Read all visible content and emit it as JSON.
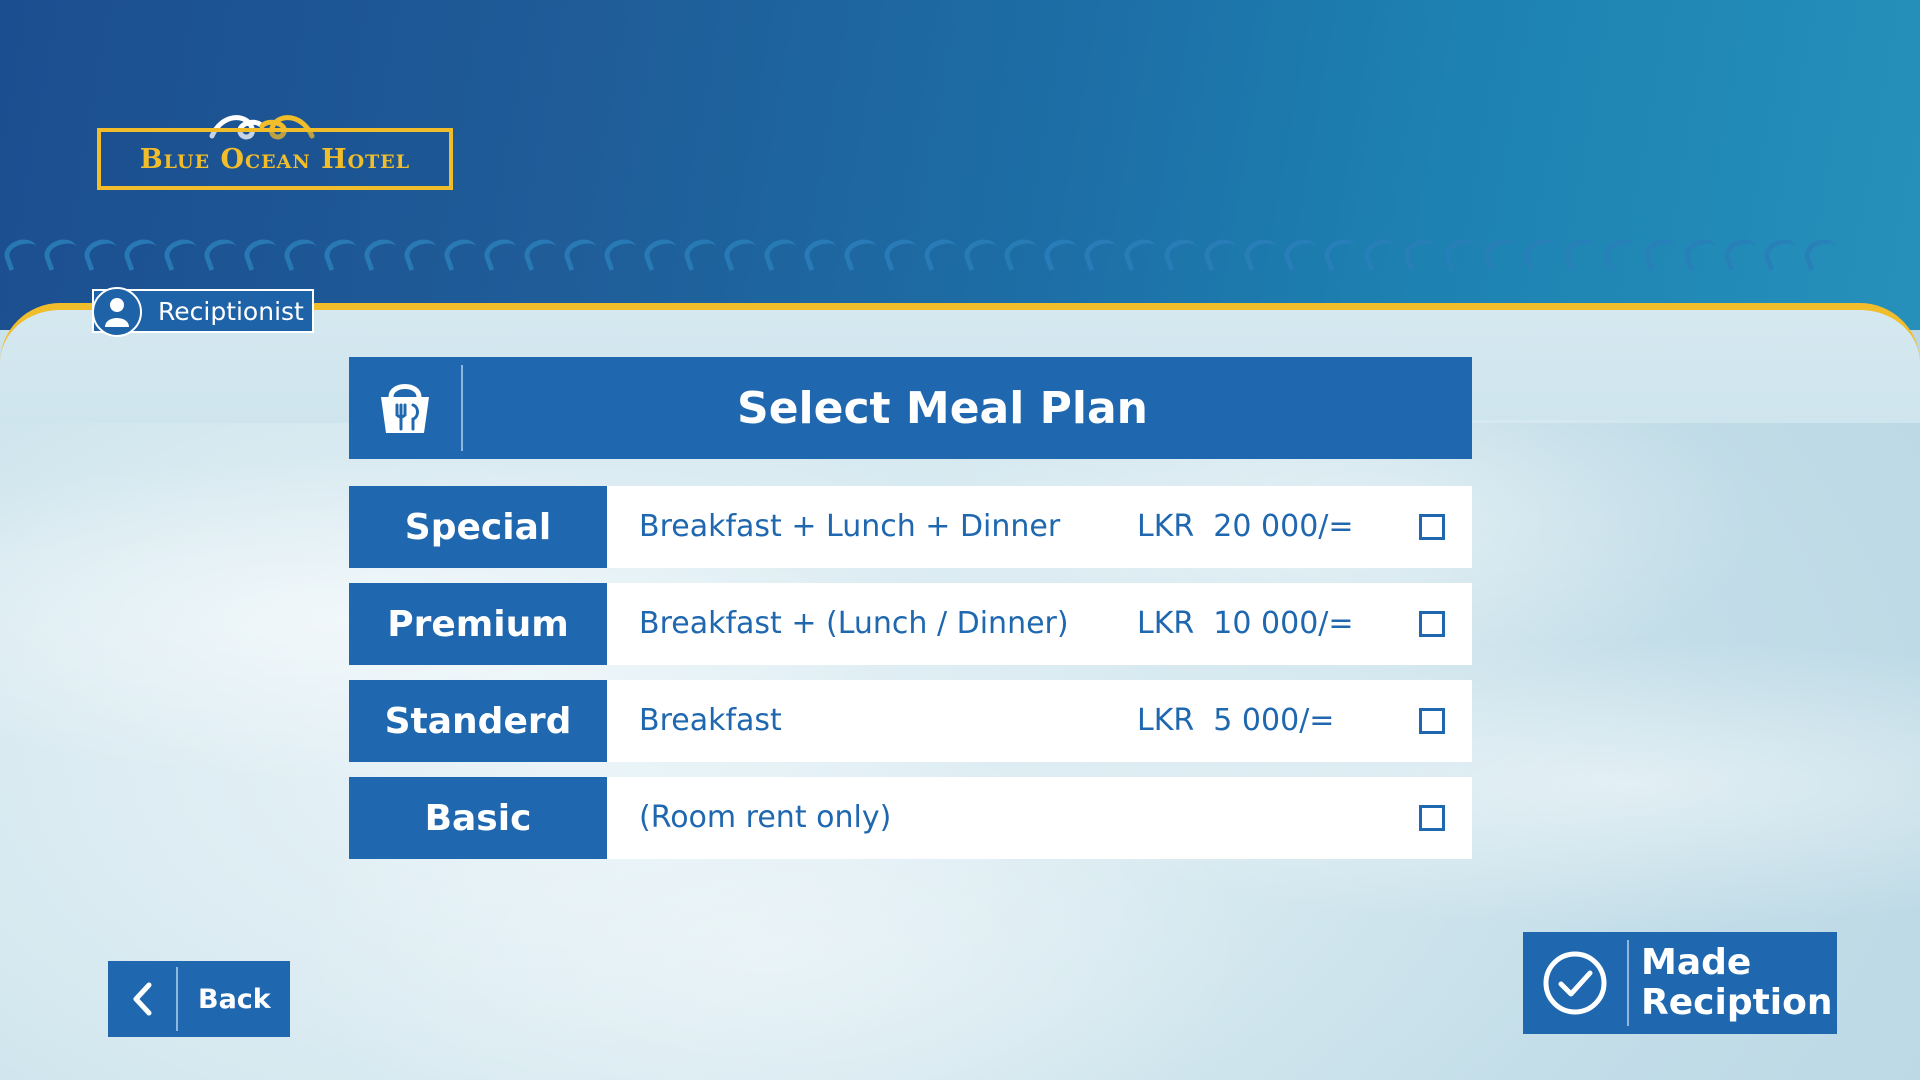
{
  "brand": {
    "name": "Blue Ocean Hotel",
    "gold": "#f1bd2b",
    "blue": "#1f68b0"
  },
  "user": {
    "role": "Reciptionist",
    "icon": "user-icon"
  },
  "panel": {
    "title": "Select Meal Plan",
    "icon": "meal-basket-icon"
  },
  "plans": [
    {
      "name": "Special",
      "description": "Breakfast + Lunch + Dinner",
      "price": "LKR  20 000/=",
      "checked": false
    },
    {
      "name": "Premium",
      "description": "Breakfast + (Lunch / Dinner)",
      "price": "LKR  10 000/=",
      "checked": false
    },
    {
      "name": "Standerd",
      "description": "Breakfast",
      "price": "LKR  5 000/=",
      "checked": false
    },
    {
      "name": "Basic",
      "description": "(Room rent only)",
      "price": "",
      "checked": false
    }
  ],
  "actions": {
    "back_label": "Back",
    "back_icon": "chevron-left-icon",
    "made_label_line1": "Made",
    "made_label_line2": "Reciption",
    "made_icon": "check-circle-icon"
  }
}
